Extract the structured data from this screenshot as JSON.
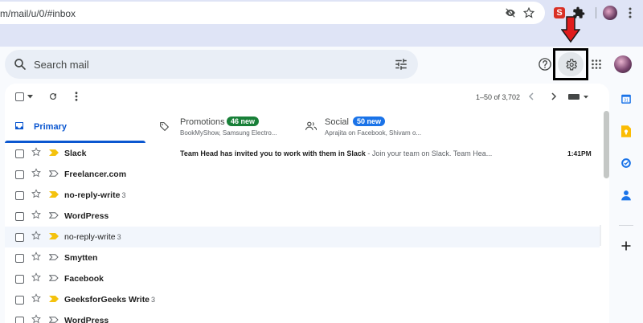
{
  "browser": {
    "url": "m/mail/u/0/#inbox",
    "extension_letter": "S"
  },
  "header": {
    "search_placeholder": "Search mail"
  },
  "toolbar": {
    "pagination": "1–50 of 3,702"
  },
  "tabs": [
    {
      "label": "Primary"
    },
    {
      "label": "Promotions",
      "badge": "46 new",
      "subtitle": "BookMyShow, Samsung Electro...",
      "badge_color": "#188038"
    },
    {
      "label": "Social",
      "badge": "50 new",
      "subtitle": "Aprajita on Facebook, Shivam o...",
      "badge_color": "#1a73e8"
    }
  ],
  "emails": [
    {
      "sender": "Slack",
      "count": "",
      "bold": true,
      "important": true
    },
    {
      "sender": "Freelancer.com",
      "count": "",
      "bold": true,
      "important": false
    },
    {
      "sender": "no-reply-write",
      "count": "3",
      "bold": true,
      "important": true
    },
    {
      "sender": "WordPress",
      "count": "",
      "bold": true,
      "important": false
    },
    {
      "sender": "no-reply-write",
      "count": "3",
      "bold": false,
      "important": true
    },
    {
      "sender": "Smytten",
      "count": "",
      "bold": true,
      "important": false
    },
    {
      "sender": "Facebook",
      "count": "",
      "bold": true,
      "important": false
    },
    {
      "sender": "GeeksforGeeks Write",
      "count": "3",
      "bold": true,
      "important": true
    },
    {
      "sender": "WordPress",
      "count": "",
      "bold": true,
      "important": false
    }
  ],
  "preview_email": {
    "subject": "Team Head has invited you to work with them in Slack",
    "snippet": " - Join your team on Slack. Team Hea...",
    "time": "1:41PM"
  },
  "colors": {
    "accent": "#0b57d0",
    "important_marker": "#f4c20d",
    "arrow": "#e01b1b"
  }
}
